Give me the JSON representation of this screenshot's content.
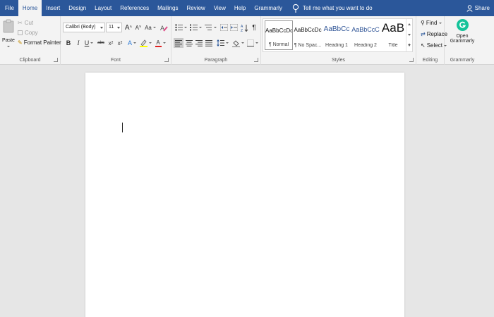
{
  "tabs": [
    "File",
    "Home",
    "Insert",
    "Design",
    "Layout",
    "References",
    "Mailings",
    "Review",
    "View",
    "Help",
    "Grammarly"
  ],
  "active_tab": "Home",
  "tell_me": "Tell me what you want to do",
  "share": "Share",
  "clipboard": {
    "label": "Clipboard",
    "paste": "Paste",
    "cut": "Cut",
    "copy": "Copy",
    "format_painter": "Format Painter"
  },
  "font": {
    "label": "Font",
    "family": "Calibri (Body)",
    "size": "11",
    "grow": "A",
    "shrink": "A",
    "change_case": "Aa",
    "bold": "B",
    "italic": "I",
    "underline": "U",
    "strike": "abc",
    "subscript": "x",
    "superscript": "x",
    "font_color": "A"
  },
  "paragraph": {
    "label": "Paragraph",
    "pilcrow": "¶"
  },
  "styles": {
    "label": "Styles",
    "items": [
      {
        "sample": "AaBbCcDc",
        "name": "¶ Normal"
      },
      {
        "sample": "AaBbCcDc",
        "name": "¶ No Spac..."
      },
      {
        "sample": "AaBbCc",
        "name": "Heading 1"
      },
      {
        "sample": "AaBbCcC",
        "name": "Heading 2"
      },
      {
        "sample": "AaB",
        "name": "Title"
      }
    ]
  },
  "editing": {
    "label": "Editing",
    "find": "Find",
    "replace": "Replace",
    "select": "Select"
  },
  "grammarly": {
    "label": "Grammarly",
    "open_line1": "Open",
    "open_line2": "Grammarly"
  },
  "colors": {
    "brand": "#2b579a",
    "grammarly": "#15c39a",
    "highlight": "#ffff00",
    "font_color": "#e02020"
  }
}
